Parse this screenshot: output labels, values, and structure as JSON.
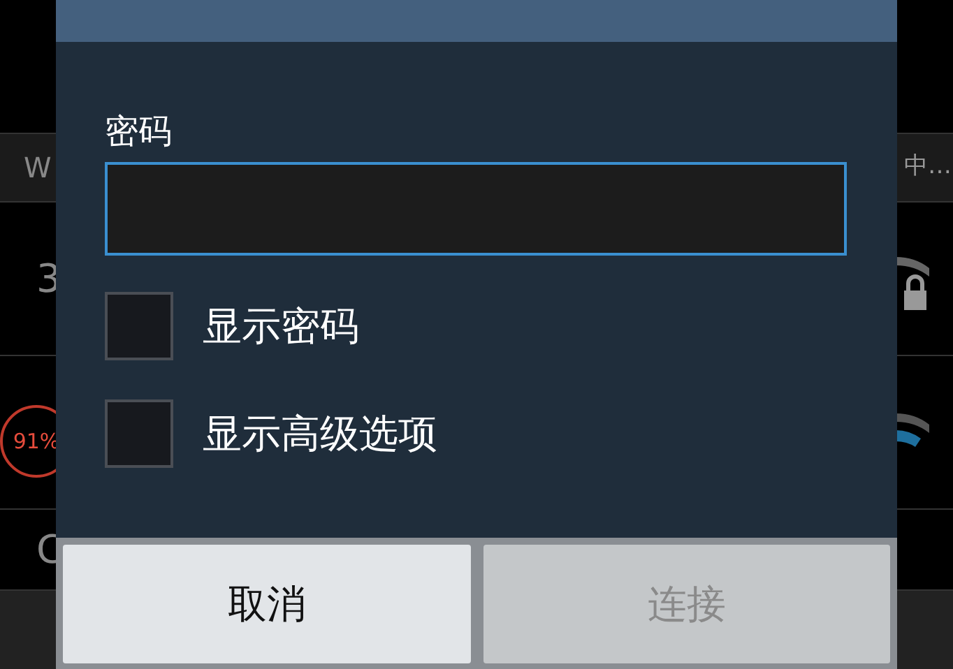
{
  "background": {
    "rows": [
      {
        "text": "W",
        "trailing": "中…"
      },
      {
        "text": "3"
      },
      {},
      {
        "text": "C"
      }
    ],
    "battery_badge": "91%"
  },
  "dialog": {
    "password": {
      "label": "密码"
    },
    "options": [
      {
        "label": "显示密码",
        "checked": false
      },
      {
        "label": "显示高级选项",
        "checked": false
      }
    ],
    "buttons": [
      {
        "label": "取消",
        "disabled": false
      },
      {
        "label": "连接",
        "disabled": true
      }
    ]
  }
}
